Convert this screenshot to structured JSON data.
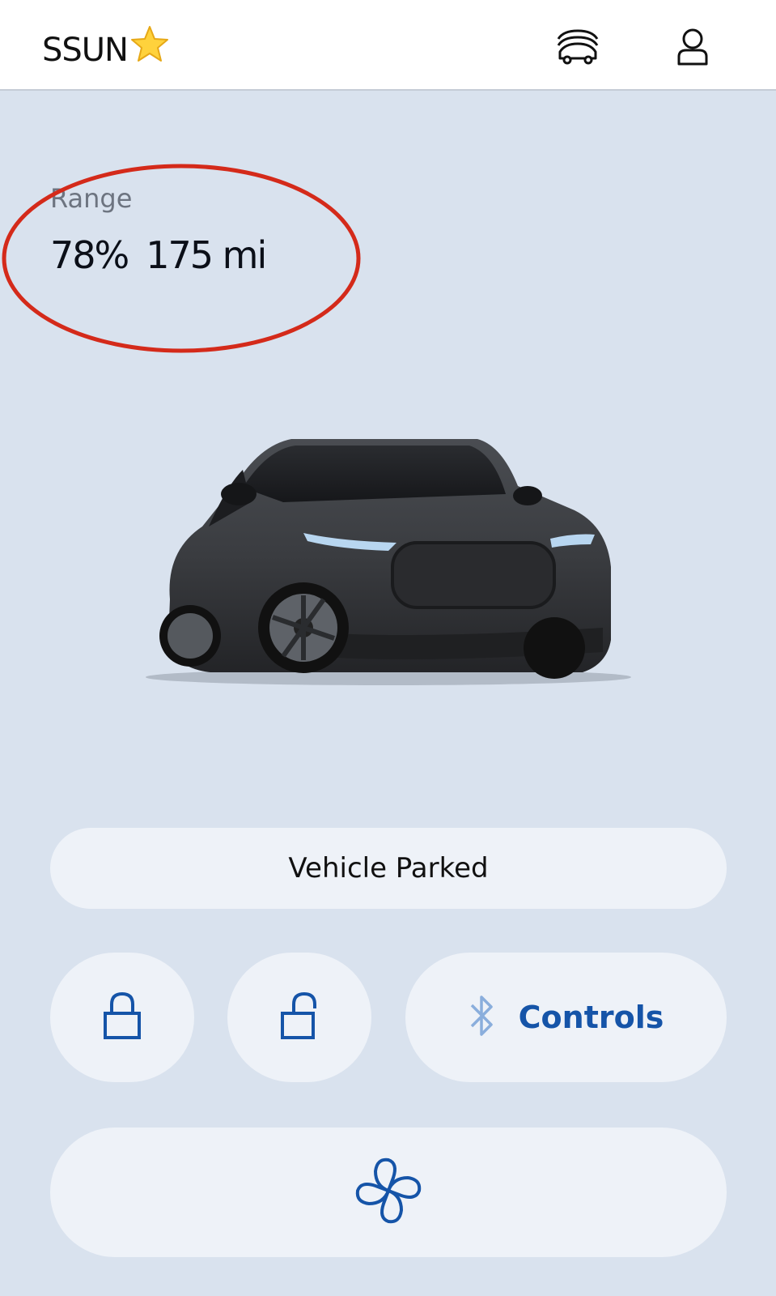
{
  "header": {
    "title": "SSUN",
    "title_emoji": "⭐",
    "garage_icon": "vehicles-icon",
    "account_icon": "account-icon"
  },
  "range": {
    "label": "Range",
    "percent": "78%",
    "distance": "175 mi"
  },
  "status": {
    "text": "Vehicle Parked"
  },
  "actions": {
    "lock_icon": "lock-icon",
    "unlock_icon": "unlock-icon",
    "controls_label": "Controls",
    "controls_icon": "bluetooth-icon",
    "climate_icon": "fan-icon"
  },
  "colors": {
    "background": "#d9e2ee",
    "accent": "#1554a8",
    "annotation": "#d42a1a"
  }
}
